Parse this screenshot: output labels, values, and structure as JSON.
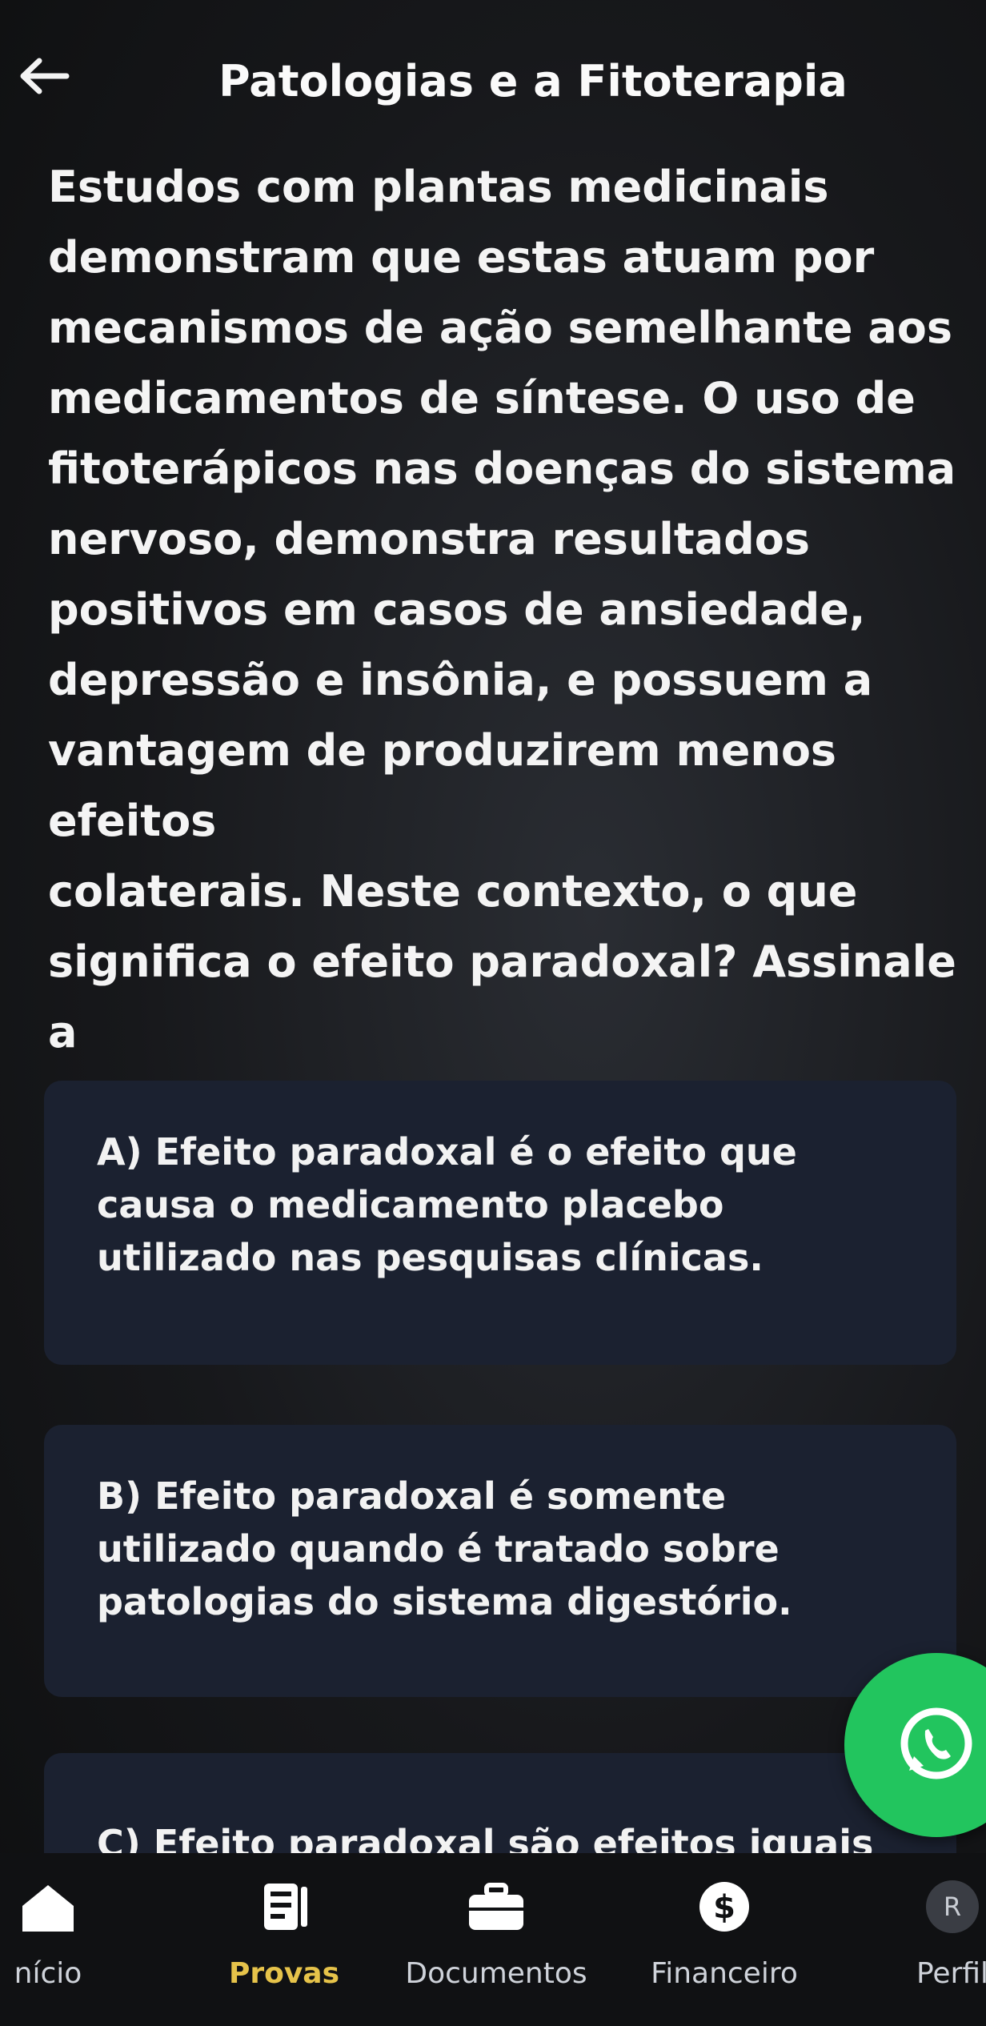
{
  "header": {
    "title": "Patologias e a Fitoterapia"
  },
  "question": {
    "text": "Estudos com plantas medicinais\ndemonstram que estas atuam por\nmecanismos de ação semelhante aos\nmedicamentos de síntese. O uso de\nfitoterápicos nas doenças do sistema\nnervoso, demonstra resultados\npositivos em casos de ansiedade,\ndepressão e insônia, e possuem a\nvantagem de produzirem menos efeitos\ncolaterais. Neste contexto, o que\nsignifica o efeito paradoxal? Assinale a\nalternativa que melhor responde este\nquestionamento."
  },
  "options": [
    {
      "text": "A) Efeito paradoxal é o efeito que causa o medicamento placebo utilizado nas pesquisas clínicas."
    },
    {
      "text": "B) Efeito paradoxal é somente utilizado quando é tratado sobre patologias do sistema digestório."
    },
    {
      "text": "C) Efeito paradoxal são efeitos iguais ao"
    }
  ],
  "bottom_nav": {
    "items": [
      {
        "label": "nício",
        "icon": "home-icon"
      },
      {
        "label": "Provas",
        "icon": "exam-icon",
        "active": true
      },
      {
        "label": "Documentos",
        "icon": "briefcase-icon"
      },
      {
        "label": "Financeiro",
        "icon": "dollar-icon"
      },
      {
        "label": "Perfil",
        "icon": "profile-icon",
        "avatar_letter": "R"
      }
    ]
  },
  "colors": {
    "accent": "#e6c34a",
    "card": "#1b2130",
    "whatsapp": "#22c55e",
    "background": "#141517"
  }
}
